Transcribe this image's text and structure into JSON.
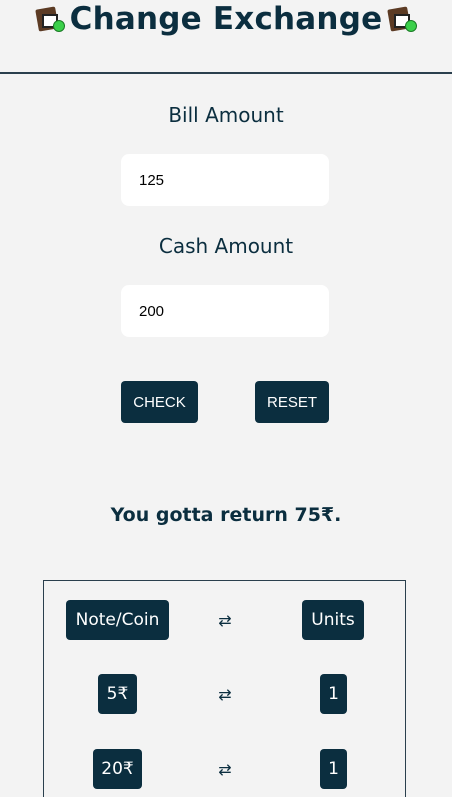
{
  "app": {
    "title": "Change Exchange",
    "title_icon": "money-exchange-icon"
  },
  "form": {
    "bill_label": "Bill Amount",
    "bill_value": "125",
    "cash_label": "Cash Amount",
    "cash_value": "200",
    "check_label": "CHECK",
    "reset_label": "RESET"
  },
  "result": {
    "message": "You gotta return 75₹."
  },
  "table": {
    "header": {
      "left": "Note/Coin",
      "arrow": "⇄",
      "right": "Units"
    },
    "rows": [
      {
        "note": "5₹",
        "arrow": "⇄",
        "units": "1"
      },
      {
        "note": "20₹",
        "arrow": "⇄",
        "units": "1"
      }
    ]
  },
  "colors": {
    "accent": "#0b2e3f",
    "background": "#f3f3f3",
    "input_bg": "#ffffff"
  }
}
